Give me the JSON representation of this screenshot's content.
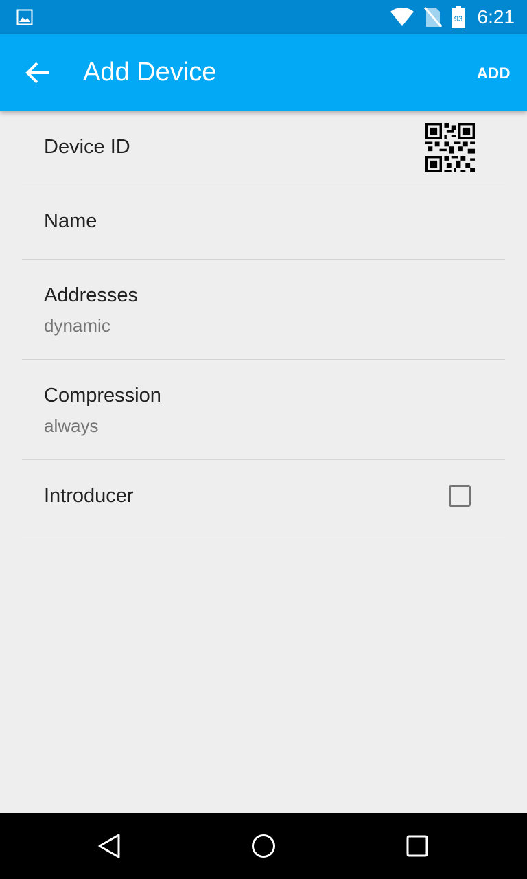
{
  "status_bar": {
    "time": "6:21",
    "battery_level": "93",
    "icons": [
      "image-notification-icon",
      "wifi-icon",
      "no-sim-icon",
      "battery-icon"
    ]
  },
  "app_bar": {
    "title": "Add Device",
    "action_label": "ADD",
    "background_color": "#03a9f4",
    "status_color": "#0288d1"
  },
  "settings": [
    {
      "key": "device_id",
      "label": "Device ID",
      "accessory": "qr-code-icon"
    },
    {
      "key": "name",
      "label": "Name"
    },
    {
      "key": "addresses",
      "label": "Addresses",
      "value": "dynamic"
    },
    {
      "key": "compression",
      "label": "Compression",
      "value": "always"
    },
    {
      "key": "introducer",
      "label": "Introducer",
      "checked": false
    }
  ],
  "nav_bar": {
    "buttons": [
      "back-icon",
      "home-icon",
      "recents-icon"
    ]
  }
}
